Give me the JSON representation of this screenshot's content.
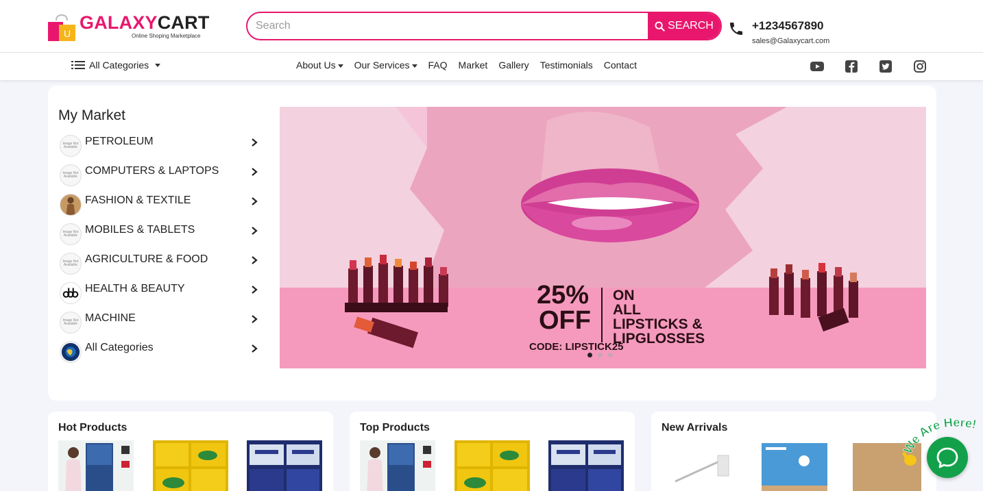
{
  "header": {
    "logo_primary": "GALAXY",
    "logo_secondary": "CART",
    "logo_tagline": "Online Shoping Marketplace",
    "search_placeholder": "Search",
    "search_button": "SEARCH",
    "phone": "+1234567890",
    "email": "sales@Galaxycart.com"
  },
  "nav": {
    "all_categories": "All Categories",
    "links": [
      "About Us",
      "Our Services",
      "FAQ",
      "Market",
      "Gallery",
      "Testimonials",
      "Contact"
    ],
    "socials": [
      "youtube-icon",
      "facebook-icon",
      "twitter-icon",
      "instagram-icon"
    ]
  },
  "market": {
    "title": "My Market",
    "categories": [
      {
        "label": "PETROLEUM",
        "thumb": "image-not-available"
      },
      {
        "label": "COMPUTERS & LAPTOPS",
        "thumb": "image-not-available"
      },
      {
        "label": "FASHION & TEXTILE",
        "thumb": "fashion-photo"
      },
      {
        "label": "MOBILES & TABLETS",
        "thumb": "image-not-available"
      },
      {
        "label": "AGRICULTURE & FOOD",
        "thumb": "image-not-available"
      },
      {
        "label": "HEALTH & BEAUTY",
        "thumb": "health-beauty-logo"
      },
      {
        "label": "MACHINE",
        "thumb": "image-not-available"
      },
      {
        "label": "All Categories",
        "thumb": "globe-icon"
      }
    ],
    "thumb_placeholder": "Image Not Available"
  },
  "banner": {
    "discount": "25%",
    "off": "OFF",
    "code": "CODE: LIPSTICK25",
    "line1": "ON",
    "line2": "ALL",
    "line3": "LIPSTICKS &",
    "line4": "LIPGLOSSES",
    "slide_count": 3,
    "active_slide": 1
  },
  "sections": {
    "hot": "Hot Products",
    "top": "Top Products",
    "new": "New Arrivals"
  },
  "chat": {
    "badge": "We Are Here!"
  },
  "colors": {
    "brand": "#e8176d",
    "chat": "#12a14a"
  }
}
